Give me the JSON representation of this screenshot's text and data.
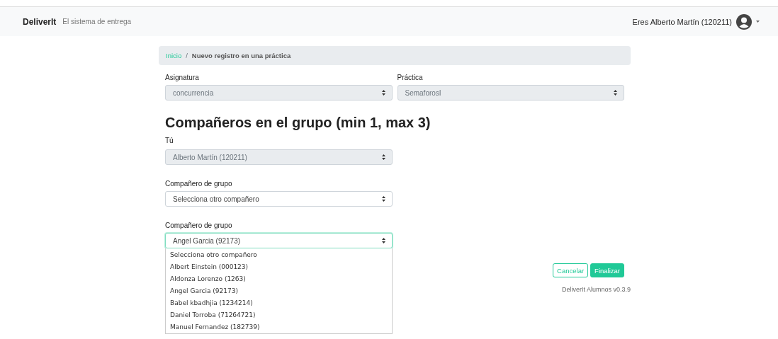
{
  "navbar": {
    "brand": "DeliverIt",
    "tagline": "El sistema de entrega",
    "user": "Eres Alberto Martín (120211)"
  },
  "breadcrumb": {
    "link": "Inicio",
    "separator": "/",
    "current": "Nuevo registro en una práctica"
  },
  "top_fields": [
    {
      "label": "Asignatura",
      "value": "concurrencia",
      "disabled": true
    },
    {
      "label": "Práctica",
      "value": "SemaforosI",
      "disabled": true
    }
  ],
  "heading": "Compañeros en el grupo (min 1, max 3)",
  "member_fields": [
    {
      "label": "Tú",
      "value": "Alberto Martín (120211)",
      "disabled": true,
      "focused": false
    },
    {
      "label": "Compañero de grupo",
      "value": "Selecciona otro compañero",
      "disabled": false,
      "focused": false
    },
    {
      "label": "Compañero de grupo",
      "value": "Angel Garcia (92173)",
      "disabled": false,
      "focused": true,
      "options": [
        "Selecciona otro compañero",
        "Albert Einstein (000123)",
        "Aldonza Lorenzo (1263)",
        "Angel Garcia (92173)",
        "Babel kbadhjia (1234214)",
        "Daniel Torroba (71264721)",
        "Manuel Fernandez (182739)"
      ]
    }
  ],
  "buttons": [
    {
      "label": "Cancelar",
      "kind": "outline"
    },
    {
      "label": "Finalizar",
      "kind": "primary"
    }
  ],
  "footer": "DeliverIt Alumnos v0.3.9"
}
